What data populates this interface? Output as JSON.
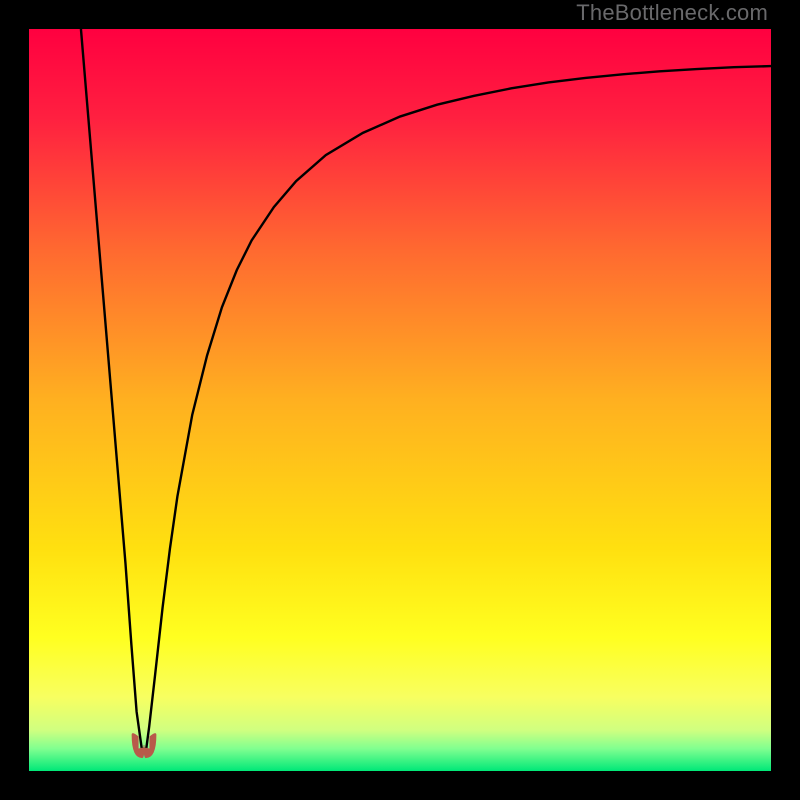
{
  "watermark": "TheBottleneck.com",
  "chart_data": {
    "type": "line",
    "title": "",
    "xlabel": "",
    "ylabel": "",
    "xlim": [
      0,
      100
    ],
    "ylim": [
      0,
      100
    ],
    "grid": false,
    "background": {
      "type": "vertical-gradient",
      "stops": [
        {
          "pos": 0.0,
          "color": "#ff0040"
        },
        {
          "pos": 0.12,
          "color": "#ff2040"
        },
        {
          "pos": 0.3,
          "color": "#ff6a30"
        },
        {
          "pos": 0.5,
          "color": "#ffb020"
        },
        {
          "pos": 0.7,
          "color": "#ffe010"
        },
        {
          "pos": 0.82,
          "color": "#ffff20"
        },
        {
          "pos": 0.9,
          "color": "#f8ff60"
        },
        {
          "pos": 0.945,
          "color": "#d0ff80"
        },
        {
          "pos": 0.97,
          "color": "#80ff90"
        },
        {
          "pos": 1.0,
          "color": "#00e878"
        }
      ]
    },
    "series": [
      {
        "name": "curve",
        "color": "#000000",
        "width": 2.4,
        "x": [
          7.0,
          8.0,
          9.0,
          10.0,
          11.0,
          12.0,
          13.0,
          13.8,
          14.5,
          15.2,
          15.8,
          16.2,
          17.0,
          18.0,
          19.0,
          20.0,
          22.0,
          24.0,
          26.0,
          28.0,
          30.0,
          33.0,
          36.0,
          40.0,
          45.0,
          50.0,
          55.0,
          60.0,
          65.0,
          70.0,
          75.0,
          80.0,
          85.0,
          90.0,
          95.0,
          100.0
        ],
        "y": [
          100.0,
          88.0,
          76.0,
          64.0,
          52.0,
          40.0,
          28.0,
          17.0,
          8.0,
          3.0,
          3.0,
          6.0,
          13.0,
          22.0,
          30.0,
          37.0,
          48.0,
          56.0,
          62.5,
          67.5,
          71.5,
          76.0,
          79.5,
          83.0,
          86.0,
          88.2,
          89.8,
          91.0,
          92.0,
          92.8,
          93.4,
          93.9,
          94.3,
          94.6,
          94.85,
          95.0
        ]
      }
    ],
    "markers": [
      {
        "name": "dip-marker",
        "shape": "u",
        "color": "#b85a4a",
        "x": 15.5,
        "y": 3.2,
        "width": 3.2,
        "height": 2.8
      }
    ]
  }
}
